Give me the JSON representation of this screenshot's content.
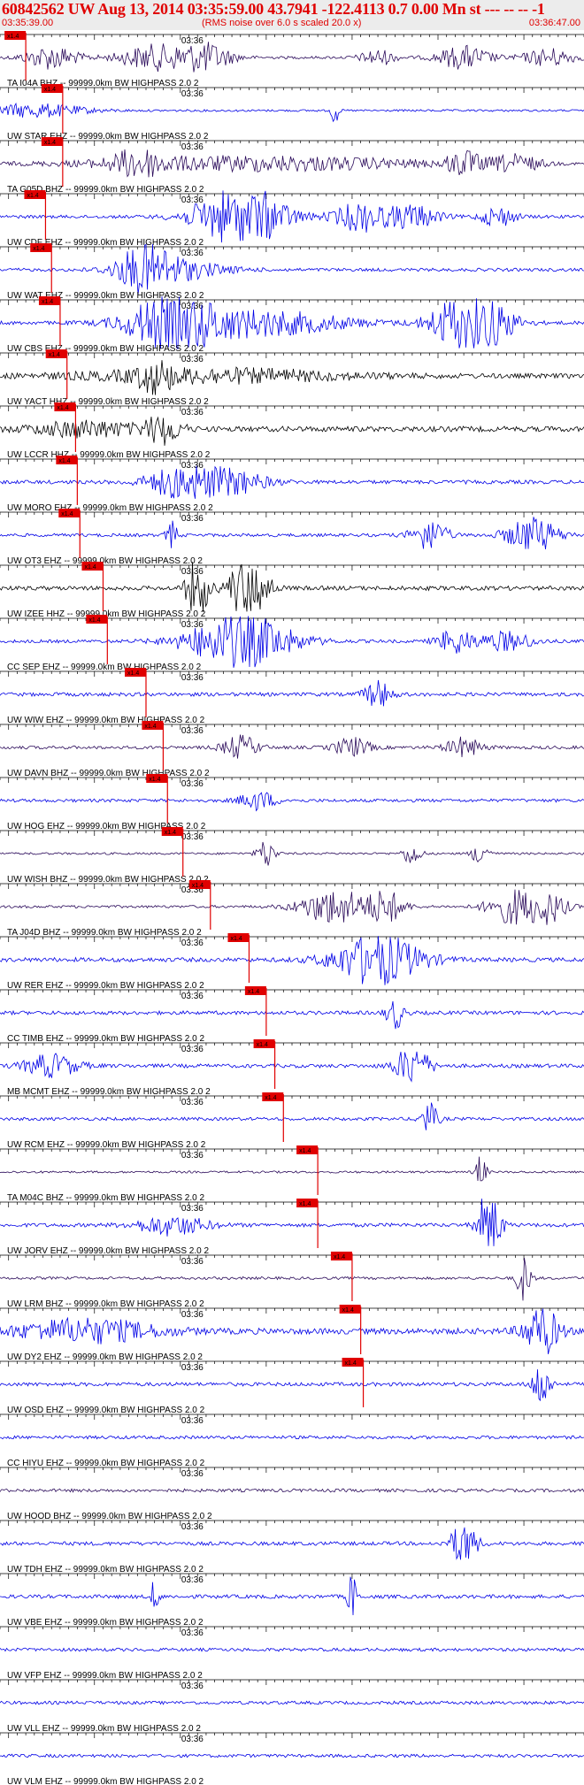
{
  "header": {
    "title": "60842562 UW Aug 13, 2014 03:35:59.00   43.7941 -122.4113  0.7 0.00 Mn st --- -- --  -1",
    "start_time": "03:35:39.00",
    "note": "(RMS noise over 6.0 s scaled 20.0 x)",
    "end_time": "03:36:47.00"
  },
  "colors": {
    "trace_blue": "#0000e6",
    "trace_purple": "#2a0a5a",
    "trace_black": "#000000",
    "pick_red": "#e00000"
  },
  "chart_data": {
    "type": "line",
    "title": "",
    "time_axis": {
      "start": "03:35:39.00",
      "end": "03:36:47.00",
      "minute_label": "03:36",
      "major_tick_seconds": 10
    },
    "pick_label": "x1.4",
    "traces": [
      {
        "label": "TA I04A BHZ -- 99999.0km BW  HIGHPASS  2.0  2",
        "color": "purple",
        "pick": "03:35:42.0",
        "amp": 0.25,
        "bursts": [
          [
            6,
            3,
            1.2
          ],
          [
            18,
            4,
            1.3
          ],
          [
            24,
            3,
            1.4
          ],
          [
            44,
            2,
            0.8
          ],
          [
            54,
            3,
            1.2
          ],
          [
            64,
            3,
            0.9
          ]
        ]
      },
      {
        "label": "UW STAR EHZ -- 99999.0km BW  HIGHPASS  2.0  2",
        "color": "blue",
        "pick": "03:35:46.3",
        "amp": 0.2,
        "bursts": [
          [
            4,
            6,
            0.7
          ],
          [
            39,
            0.4,
            1.8
          ]
        ]
      },
      {
        "label": "TA G05D BHZ -- 99999.0km BW  HIGHPASS  2.0  2",
        "color": "purple",
        "pick": "03:35:46.3",
        "amp": 0.2,
        "bursts": [
          [
            16,
            3,
            1.2
          ],
          [
            30,
            20,
            0.8
          ],
          [
            54,
            2,
            1.2
          ],
          [
            60,
            3,
            0.9
          ]
        ]
      },
      {
        "label": "UW CDF EHZ -- 99999.0km BW  HIGHPASS  2.0  2",
        "color": "blue",
        "pick": "03:35:44.3",
        "amp": 0.3,
        "bursts": [
          [
            28,
            5,
            3.5
          ],
          [
            42,
            3,
            1.5
          ],
          [
            48,
            3,
            1.2
          ],
          [
            58,
            2,
            1.0
          ]
        ]
      },
      {
        "label": "UW WAT EHZ -- 99999.0km BW  HIGHPASS  2.0  2",
        "color": "blue",
        "pick": "03:35:45.0",
        "amp": 0.3,
        "bursts": [
          [
            17,
            3,
            2.2
          ],
          [
            20,
            6,
            1.0
          ]
        ]
      },
      {
        "label": "UW CBS EHZ -- 99999.0km BW  HIGHPASS  2.0  2",
        "color": "blue",
        "pick": "03:35:46.0",
        "amp": 0.35,
        "bursts": [
          [
            20,
            5,
            2.8
          ],
          [
            30,
            10,
            1.3
          ],
          [
            53,
            3,
            2.4
          ],
          [
            57,
            3,
            2.2
          ]
        ]
      },
      {
        "label": "UW YACT HHZ -- 99999.0km BW  HIGHPASS  2.0  2",
        "color": "black",
        "pick": "03:35:46.8",
        "amp": 0.45,
        "bursts": [
          [
            18,
            2,
            1.3
          ],
          [
            25,
            15,
            0.7
          ]
        ]
      },
      {
        "label": "UW LCCR HHZ -- 99999.0km BW  HIGHPASS  2.0  2",
        "color": "black",
        "pick": "03:35:47.8",
        "amp": 0.5,
        "bursts": [
          [
            19,
            2,
            1.5
          ],
          [
            10,
            6,
            0.8
          ]
        ]
      },
      {
        "label": "UW MORO EHZ -- 99999.0km BW  HIGHPASS  2.0  2",
        "color": "blue",
        "pick": "03:35:48.0",
        "amp": 0.35,
        "bursts": [
          [
            21,
            4,
            1.6
          ],
          [
            27,
            4,
            1.2
          ]
        ]
      },
      {
        "label": "UW OT3 EHZ -- 99999.0km BW  HIGHPASS  2.0  2",
        "color": "blue",
        "pick": "03:35:48.3",
        "amp": 0.3,
        "bursts": [
          [
            20,
            0.6,
            1.5
          ],
          [
            50,
            2,
            1.6
          ],
          [
            62,
            3,
            1.8
          ]
        ]
      },
      {
        "label": "UW IZEE HHZ -- 99999.0km BW  HIGHPASS  2.0  2",
        "color": "black",
        "pick": "03:35:51.0",
        "amp": 0.4,
        "bursts": [
          [
            23,
            1.2,
            3.5
          ],
          [
            29,
            2,
            4.5
          ]
        ]
      },
      {
        "label": "CC SEP EHZ -- 99999.0km BW  HIGHPASS  2.0  2",
        "color": "blue",
        "pick": "03:35:51.5",
        "amp": 0.3,
        "bursts": [
          [
            28,
            6,
            2.8
          ],
          [
            53,
            2,
            1.3
          ],
          [
            59,
            3,
            1.0
          ]
        ]
      },
      {
        "label": "UW WIW EHZ -- 99999.0km BW  HIGHPASS  2.0  2",
        "color": "blue",
        "pick": "03:35:56.0",
        "amp": 0.35,
        "bursts": [
          [
            44,
            1.5,
            1.4
          ]
        ]
      },
      {
        "label": "UW DAVN BHZ -- 99999.0km BW  HIGHPASS  2.0  2",
        "color": "purple",
        "pick": "03:35:58.0",
        "amp": 0.3,
        "bursts": [
          [
            28,
            2,
            1.2
          ],
          [
            41,
            2,
            1.0
          ],
          [
            54,
            2,
            1.0
          ]
        ]
      },
      {
        "label": "UW HOG EHZ -- 99999.0km BW  HIGHPASS  2.0  2",
        "color": "blue",
        "pick": "03:35:58.5",
        "amp": 0.3,
        "bursts": [
          [
            30,
            2,
            1.0
          ]
        ]
      },
      {
        "label": "UW WISH BHZ -- 99999.0km BW  HIGHPASS  2.0  2",
        "color": "purple",
        "pick": "03:36:00.3",
        "amp": 0.2,
        "bursts": [
          [
            31,
            1,
            1.5
          ],
          [
            48,
            1,
            1.2
          ],
          [
            56,
            1,
            1.2
          ]
        ]
      },
      {
        "label": "TA J04D BHZ -- 99999.0km BW  HIGHPASS  2.0  2",
        "color": "purple",
        "pick": "03:36:03.5",
        "amp": 0.25,
        "bursts": [
          [
            39,
            4,
            1.8
          ],
          [
            45,
            2,
            1.6
          ],
          [
            60,
            3,
            1.8
          ],
          [
            64,
            2,
            1.4
          ]
        ]
      },
      {
        "label": "UW RER EHZ -- 99999.0km BW  HIGHPASS  2.0  2",
        "color": "blue",
        "pick": "03:36:08.0",
        "amp": 0.4,
        "bursts": [
          [
            44,
            5,
            2.6
          ]
        ]
      },
      {
        "label": "CC TIMB EHZ -- 99999.0km BW  HIGHPASS  2.0  2",
        "color": "blue",
        "pick": "03:36:10.0",
        "amp": 0.35,
        "bursts": [
          [
            46,
            1,
            1.6
          ]
        ]
      },
      {
        "label": "MB MCMT EHZ -- 99999.0km BW  HIGHPASS  2.0  2",
        "color": "blue",
        "pick": "03:36:11.0",
        "amp": 0.35,
        "bursts": [
          [
            48,
            2,
            2.0
          ],
          [
            6,
            3,
            1.2
          ]
        ]
      },
      {
        "label": "UW RCM EHZ -- 99999.0km BW  HIGHPASS  2.0  2",
        "color": "blue",
        "pick": "03:36:12.0",
        "amp": 0.3,
        "bursts": [
          [
            50,
            1,
            1.6
          ]
        ]
      },
      {
        "label": "TA M04C BHZ -- 99999.0km BW  HIGHPASS  2.0  2",
        "color": "purple",
        "pick": "03:36:16.0",
        "amp": 0.2,
        "bursts": [
          [
            56,
            0.6,
            1.8
          ]
        ]
      },
      {
        "label": "UW JORV EHZ -- 99999.0km BW  HIGHPASS  2.0  2",
        "color": "blue",
        "pick": "03:36:16.0",
        "amp": 0.35,
        "bursts": [
          [
            57,
            1.2,
            4.5
          ],
          [
            20,
            4,
            1.0
          ]
        ]
      },
      {
        "label": "UW LRM BHZ -- 99999.0km BW  HIGHPASS  2.0  2",
        "color": "purple",
        "pick": "03:36:20.0",
        "amp": 0.25,
        "bursts": [
          [
            61,
            0.8,
            2.4
          ]
        ]
      },
      {
        "label": "UW DY2 EHZ -- 99999.0km BW  HIGHPASS  2.0  2",
        "color": "blue",
        "pick": "03:36:21.0",
        "amp": 0.55,
        "bursts": [
          [
            63,
            2,
            2.6
          ],
          [
            10,
            8,
            1.2
          ]
        ]
      },
      {
        "label": "UW OSD EHZ -- 99999.0km BW  HIGHPASS  2.0  2",
        "color": "blue",
        "pick": "03:36:21.3",
        "amp": 0.35,
        "bursts": [
          [
            63,
            1,
            2.4
          ]
        ]
      },
      {
        "label": "CC HIYU EHZ -- 99999.0km BW  HIGHPASS  2.0  2",
        "color": "blue",
        "pick": null,
        "amp": 0.3,
        "bursts": []
      },
      {
        "label": "UW HOOD BHZ -- 99999.0km BW  HIGHPASS  2.0  2",
        "color": "purple",
        "pick": null,
        "amp": 0.3,
        "bursts": []
      },
      {
        "label": "UW TDH EHZ -- 99999.0km BW  HIGHPASS  2.0  2",
        "color": "blue",
        "pick": null,
        "amp": 0.35,
        "bursts": [
          [
            54,
            1.5,
            2.2
          ]
        ]
      },
      {
        "label": "UW VBE EHZ -- 99999.0km BW  HIGHPASS  2.0  2",
        "color": "blue",
        "pick": null,
        "amp": 0.35,
        "bursts": [
          [
            18,
            0.5,
            1.6
          ],
          [
            41,
            0.5,
            2.6
          ]
        ]
      },
      {
        "label": "UW VFP EHZ -- 99999.0km BW  HIGHPASS  2.0  2",
        "color": "blue",
        "pick": null,
        "amp": 0.3,
        "bursts": []
      },
      {
        "label": "UW VLL EHZ -- 99999.0km BW  HIGHPASS  2.0  2",
        "color": "blue",
        "pick": null,
        "amp": 0.3,
        "bursts": []
      },
      {
        "label": "UW VLM EHZ -- 99999.0km BW  HIGHPASS  2.0  2",
        "color": "blue",
        "pick": null,
        "amp": 0.3,
        "bursts": []
      }
    ]
  }
}
